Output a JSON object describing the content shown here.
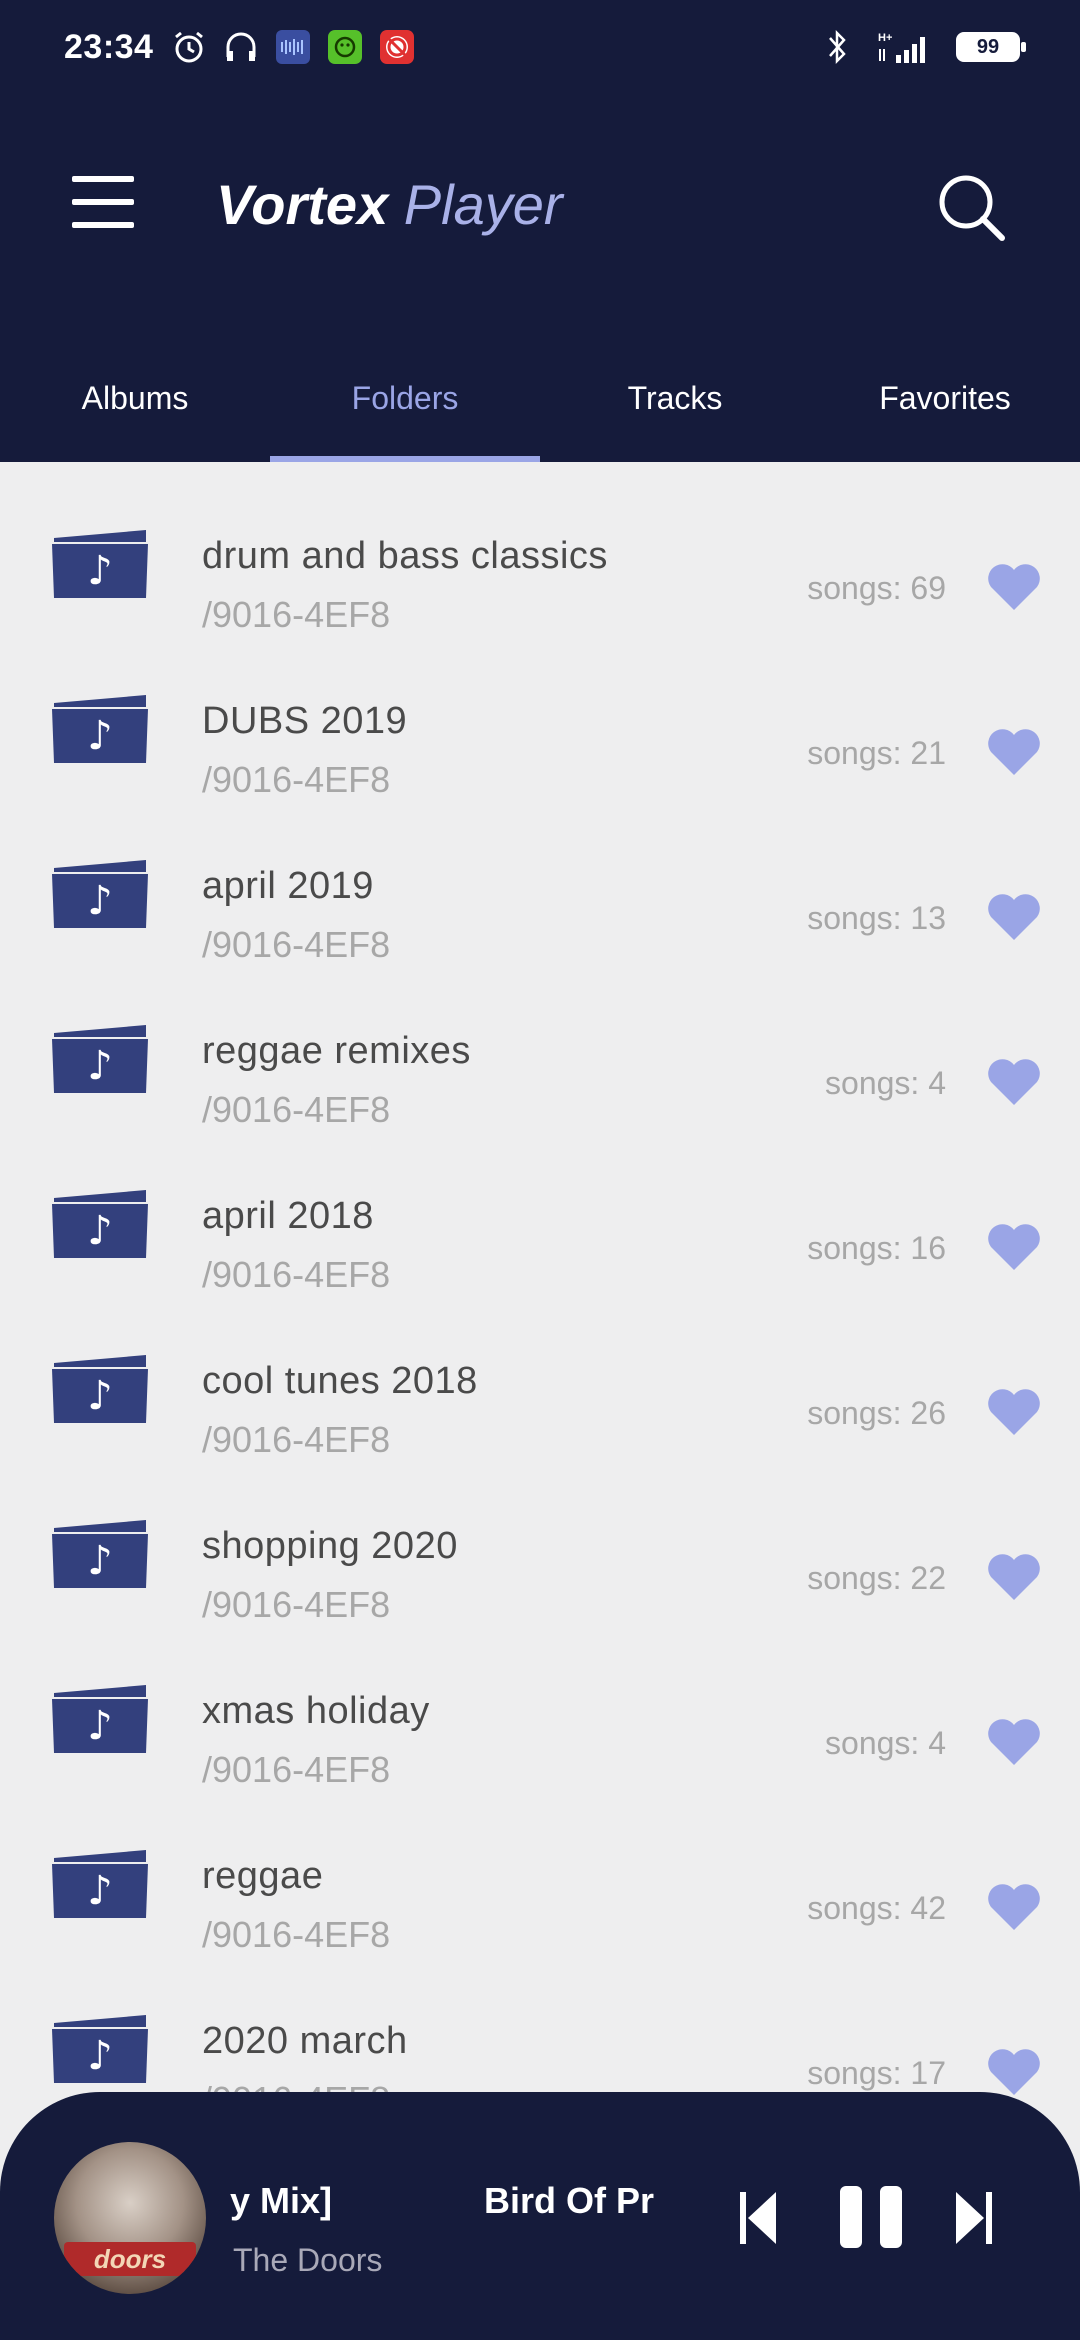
{
  "status_bar": {
    "time": "23:34",
    "left_icons": [
      "alarm-icon",
      "headphones-icon",
      "app-blue-icon",
      "app-green-icon",
      "app-red-icon"
    ],
    "right_icons": [
      "bluetooth-icon",
      "signal-icon"
    ],
    "network_type": "H+",
    "battery": "99"
  },
  "header": {
    "title_part1": "Vortex",
    "title_part2": "Player",
    "accent_color": "#a9b1e8",
    "background_color": "#151b3b"
  },
  "tabs": [
    {
      "label": "Albums",
      "active": false
    },
    {
      "label": "Folders",
      "active": true
    },
    {
      "label": "Tracks",
      "active": false
    },
    {
      "label": "Favorites",
      "active": false
    }
  ],
  "folders": [
    {
      "name": "drum and bass classics",
      "path": "/9016-4EF8",
      "count": "songs: 69"
    },
    {
      "name": "DUBS 2019",
      "path": "/9016-4EF8",
      "count": "songs: 21"
    },
    {
      "name": "april 2019",
      "path": "/9016-4EF8",
      "count": "songs: 13"
    },
    {
      "name": "reggae remixes",
      "path": "/9016-4EF8",
      "count": "songs: 4"
    },
    {
      "name": "april 2018",
      "path": "/9016-4EF8",
      "count": "songs: 16"
    },
    {
      "name": "cool tunes 2018",
      "path": "/9016-4EF8",
      "count": "songs: 26"
    },
    {
      "name": "shopping 2020",
      "path": "/9016-4EF8",
      "count": "songs: 22"
    },
    {
      "name": "xmas holiday",
      "path": "/9016-4EF8",
      "count": "songs: 4"
    },
    {
      "name": "reggae",
      "path": "/9016-4EF8",
      "count": "songs: 42"
    },
    {
      "name": "2020 march",
      "path": "/9016-4EF8",
      "count": "songs: 17"
    }
  ],
  "player": {
    "title_fragment": "y Mix]",
    "artist": "The Doors",
    "next_title_fragment": "Bird Of Pr",
    "cover_text": "doors"
  },
  "colors": {
    "folder_icon": "#33407d",
    "heart": "#9aa5e6",
    "list_background": "#eeeeef"
  }
}
